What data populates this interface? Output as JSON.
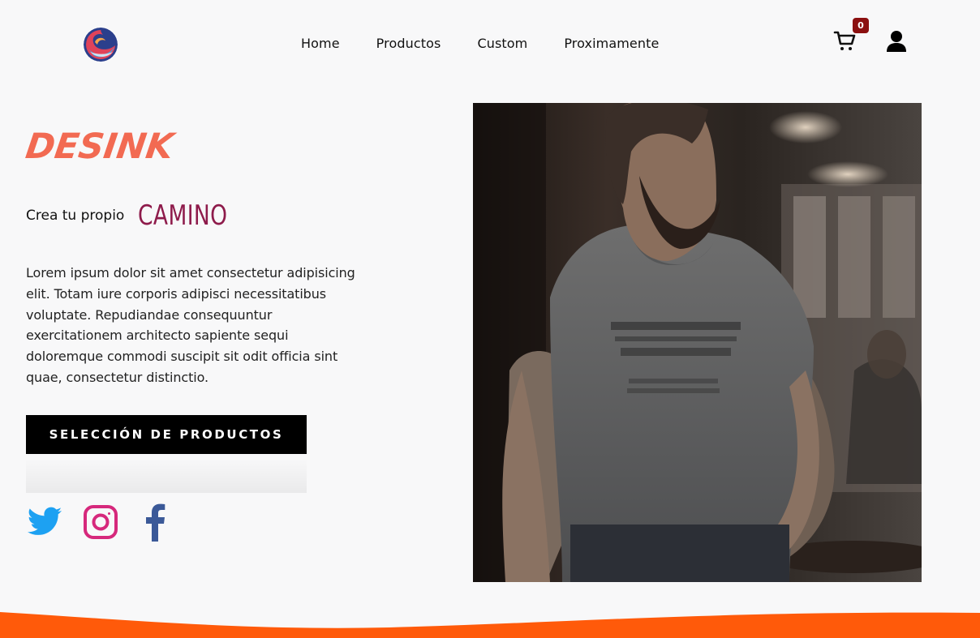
{
  "nav": {
    "links": [
      "Home",
      "Productos",
      "Custom",
      "Proximamente"
    ],
    "cart_count": "0",
    "logo_icon": "wave-logo-icon",
    "cart_icon": "shopping-cart-icon",
    "user_icon": "user-icon"
  },
  "hero": {
    "brand": "DESINK",
    "tagline": "Crea tu propio",
    "tagline_accent": "CAMINO",
    "description": "Lorem ipsum dolor sit amet consectetur adipisicing elit. Totam iure corporis adipisci necessitatibus voluptate. Repudiandae consequuntur exercitationem architecto sapiente sequi doloremque commodi suscipit sit odit officia sint quae, consectetur distinctio.",
    "cta_label": "SELECCIÓN DE PRODUCTOS",
    "image": "photo of a bearded man in a grey t-shirt"
  },
  "social": [
    "twitter-icon",
    "instagram-icon",
    "facebook-icon"
  ],
  "colors": {
    "brand": "#f26a52",
    "accent": "#8e1b4b",
    "badge": "#8b1010",
    "footer_wave": "#ff5a0a",
    "twitter": "#1da1f2",
    "instagram": "#d6287c",
    "facebook": "#3b5998"
  }
}
